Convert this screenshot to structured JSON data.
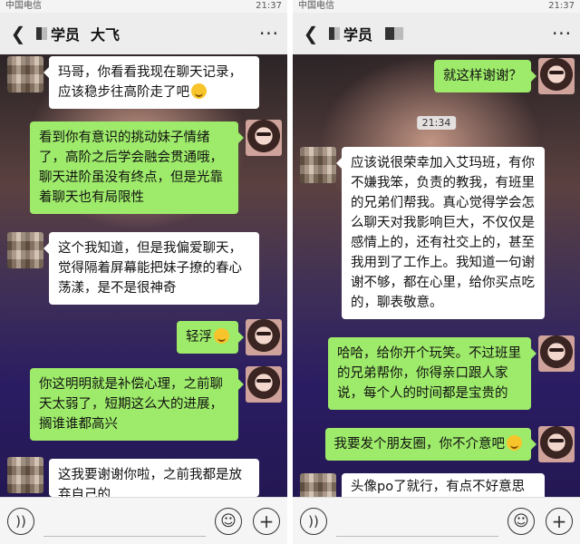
{
  "status": {
    "carrier": "中国电信",
    "time": "21:37"
  },
  "left": {
    "title": "学员",
    "title_name": "大飞",
    "messages": [
      {
        "from": "them",
        "text": "玛哥，你看看我现在聊天记录，应该稳步往高阶走了吧"
      },
      {
        "from": "me",
        "text": "看到你有意识的挑动妹子情绪了，高阶之后学会融会贯通哦，聊天进阶虽没有终点，但是光靠着聊天也有局限性"
      },
      {
        "from": "them",
        "text": "这个我知道，但是我偏爱聊天，觉得隔着屏幕能把妹子撩的春心荡漾，是不是很神奇"
      },
      {
        "from": "me",
        "text": "轻浮"
      },
      {
        "from": "me",
        "text": "你这明明就是补偿心理，之前聊天太弱了，短期这么大的进展，搁谁谁都高兴"
      },
      {
        "from": "them",
        "text": "这我要谢谢你啦，之前我都是放弃自己的"
      }
    ]
  },
  "right": {
    "title": "学员",
    "messages": [
      {
        "from": "me",
        "text": "就这样谢谢？"
      },
      {
        "timestamp": "21:34"
      },
      {
        "from": "them",
        "text": "应该说很荣幸加入艾玛班，有你不嫌我笨，负责的教我，有班里的兄弟们帮我。真心觉得学会怎么聊天对我影响巨大，不仅仅是感情上的，还有社交上的，甚至我用到了工作上。我知道一句谢谢不够，都在心里，给你买点吃的，聊表敬意。"
      },
      {
        "from": "me",
        "text": "哈哈，给你开个玩笑。不过班里的兄弟帮你，你得亲口跟人家说，每个人的时间都是宝贵的"
      },
      {
        "from": "me",
        "text": "我要发个朋友圈，你不介意吧"
      },
      {
        "from": "them",
        "text": "头像po了就行，有点不好意思"
      }
    ]
  },
  "icons": {
    "back": "back-arrow-icon",
    "more": "more-dots-icon",
    "voice": "voice-icon",
    "smiley": "smiley-icon",
    "plus": "plus-icon"
  },
  "colors": {
    "me_bubble": "#9eea6a",
    "them_bubble": "#ffffff",
    "header": "#ededed"
  }
}
